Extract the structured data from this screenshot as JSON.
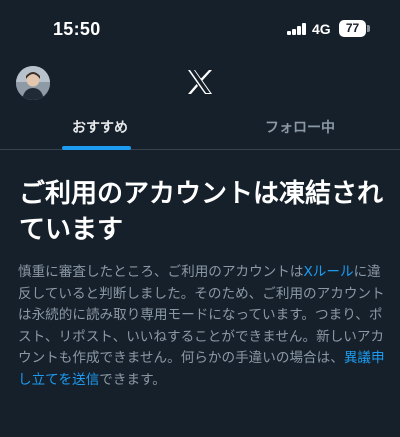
{
  "status_bar": {
    "time": "15:50",
    "network": "4G",
    "battery": "77"
  },
  "header": {
    "avatar_icon": "profile-avatar",
    "logo_icon": "x-logo-icon"
  },
  "tabs": [
    {
      "label": "おすすめ",
      "active": true
    },
    {
      "label": "フォロー中",
      "active": false
    }
  ],
  "notice": {
    "title": "ご利用のアカウントは凍結されています",
    "body_part1": "慎重に審査したところ、ご利用のアカウントは",
    "rules_link": "Xルール",
    "body_part2": "に違反していると判断しました。そのため、ご利用のアカウントは永続的に読み取り専用モードになっています。つまり、ポスト、リポスト、いいねすることができません。新しいアカウントも作成できません。何らかの手違いの場合は、",
    "appeal_link": "異議申し立てを送信",
    "body_part3": "できます。"
  },
  "colors": {
    "background": "#15202b",
    "accent": "#1d9bf0",
    "text_primary": "#e7e9ea",
    "text_secondary": "#8b98a5"
  }
}
